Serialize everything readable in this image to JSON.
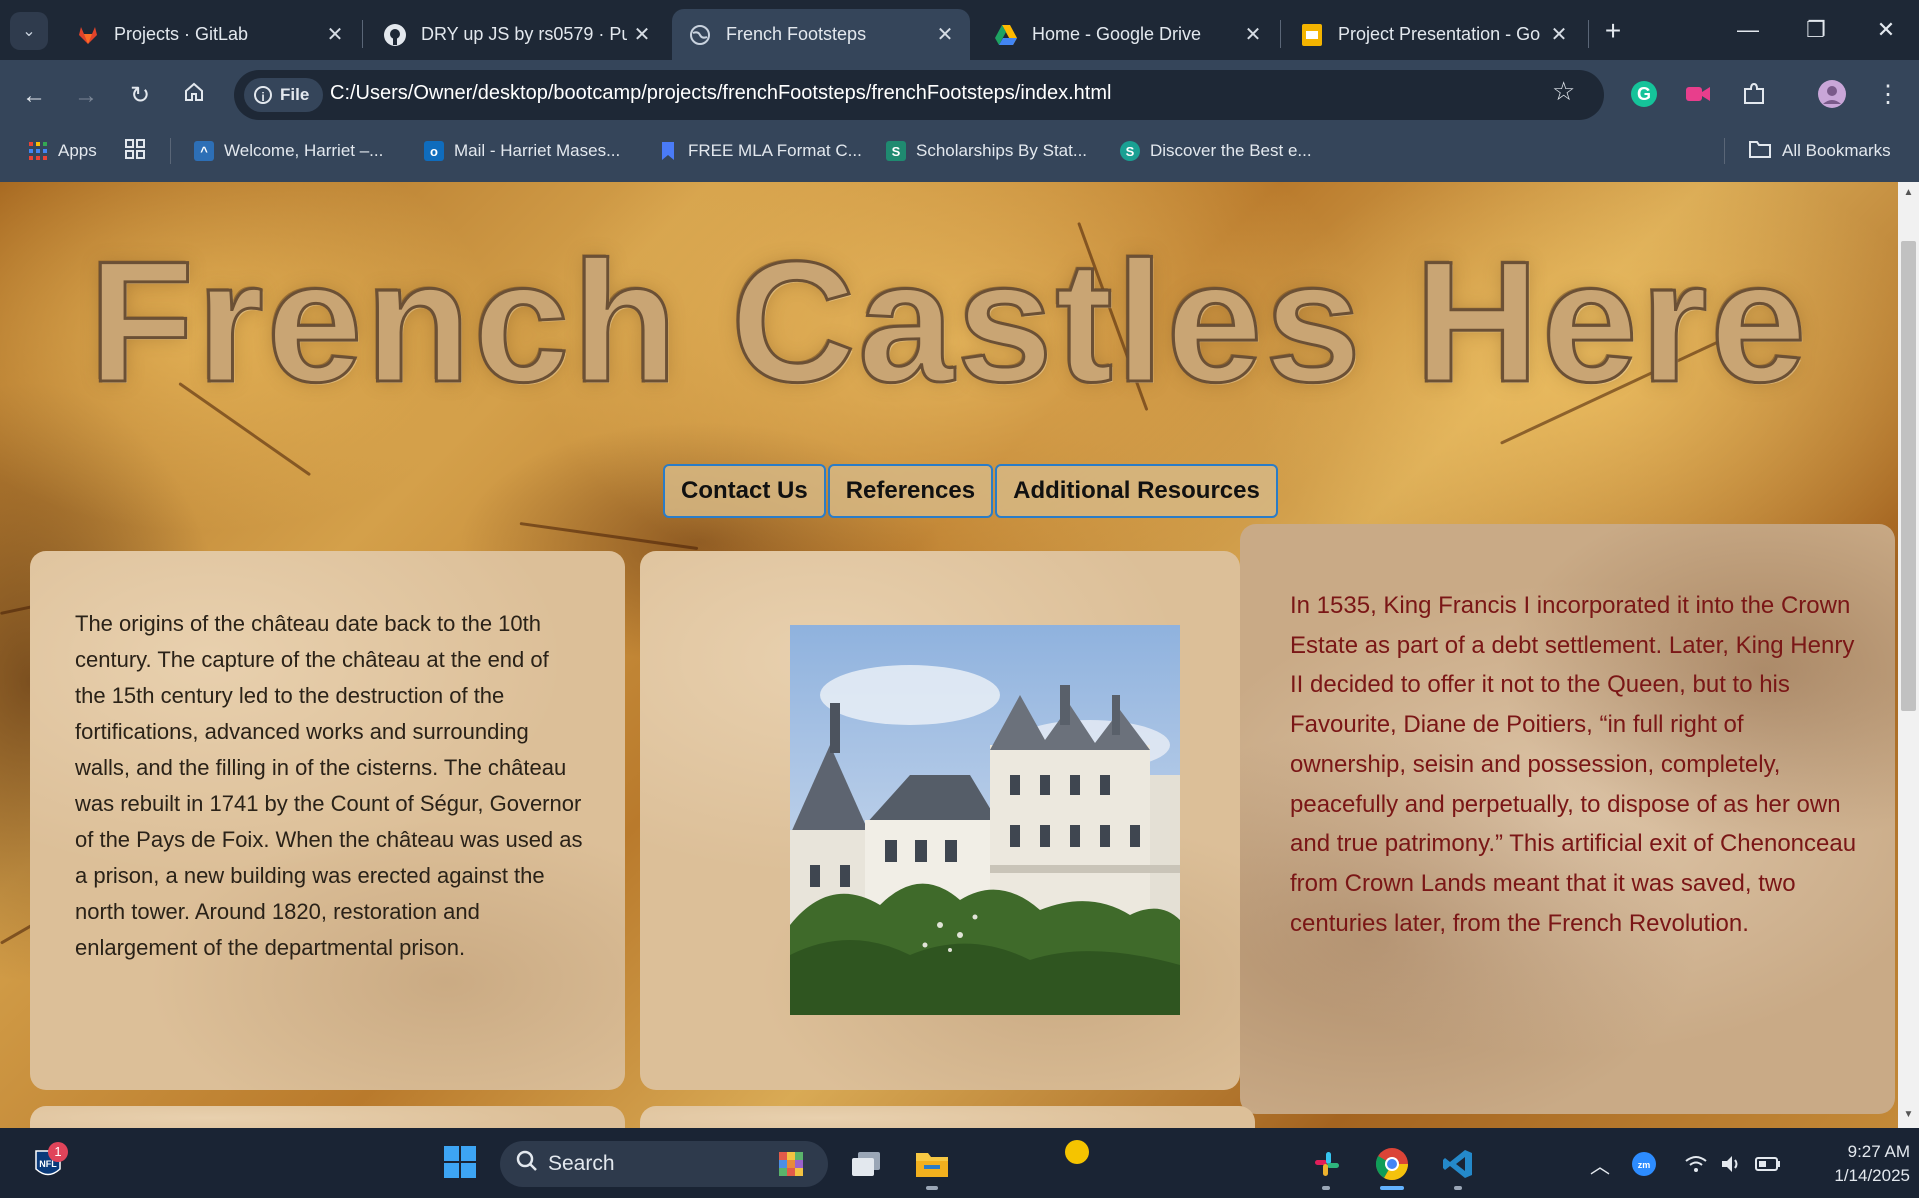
{
  "browser": {
    "tabs": [
      {
        "title": "Projects · GitLab",
        "icon": "gitlab-icon",
        "active": false
      },
      {
        "title": "DRY up JS by rs0579 · Pul",
        "icon": "github-icon",
        "active": false
      },
      {
        "title": "French Footsteps",
        "icon": "globe-icon",
        "active": true
      },
      {
        "title": "Home - Google Drive",
        "icon": "google-drive-icon",
        "active": false
      },
      {
        "title": "Project Presentation - Go",
        "icon": "google-slides-icon",
        "active": false
      }
    ],
    "address": {
      "scheme_label": "File",
      "url": "C:/Users/Owner/desktop/bootcamp/projects/frenchFootsteps/frenchFootsteps/index.html"
    },
    "bookmarks": [
      {
        "label": "Apps",
        "icon": "apps-grid-icon"
      },
      {
        "label": "Welcome, Harriet –...",
        "icon": "canvas-icon"
      },
      {
        "label": "Mail - Harriet Mases...",
        "icon": "outlook-icon"
      },
      {
        "label": "FREE MLA Format C...",
        "icon": "bookmark-icon"
      },
      {
        "label": "Scholarships By Stat...",
        "icon": "scholarships-icon"
      },
      {
        "label": "Discover the Best e...",
        "icon": "discover-icon"
      }
    ],
    "all_bookmarks_label": "All Bookmarks"
  },
  "page": {
    "title": "French Castles Here",
    "nav": [
      "Contact Us",
      "References",
      "Additional Resources"
    ],
    "card1_text": "The origins of the château date back to the 10th century. The capture of the château at the end of the 15th century led to the destruction of the fortifications, advanced works and surrounding walls, and the filling in of the cisterns. The château was rebuilt in 1741 by the Count of Ségur, Governor of the Pays de Foix. When the château was used as a prison, a new building was erected against the north tower. Around 1820, restoration and enlargement of the departmental prison.",
    "card3_text": "In 1535, King Francis I incorporated it into the Crown Estate as part of a debt settlement. Later, King Henry II decided to offer it not to the Queen, but to his Favourite, Diane de Poitiers, “in full right of ownership, seisin and possession, completely, peacefully and perpetually, to dispose of as her own and true patrimony.” This artificial exit of Chenonceau from Crown Lands meant that it was saved, two centuries later, from the French Revolution."
  },
  "taskbar": {
    "search_label": "Search",
    "notification_badge": "1",
    "time": "9:27 AM",
    "date": "1/14/2025"
  },
  "colors": {
    "chrome_dark": "#1e2836",
    "chrome_toolbar": "#35455a",
    "link_border": "#2a7cc7",
    "card3_text": "#7a1616",
    "title_fill": "#c9a574"
  }
}
